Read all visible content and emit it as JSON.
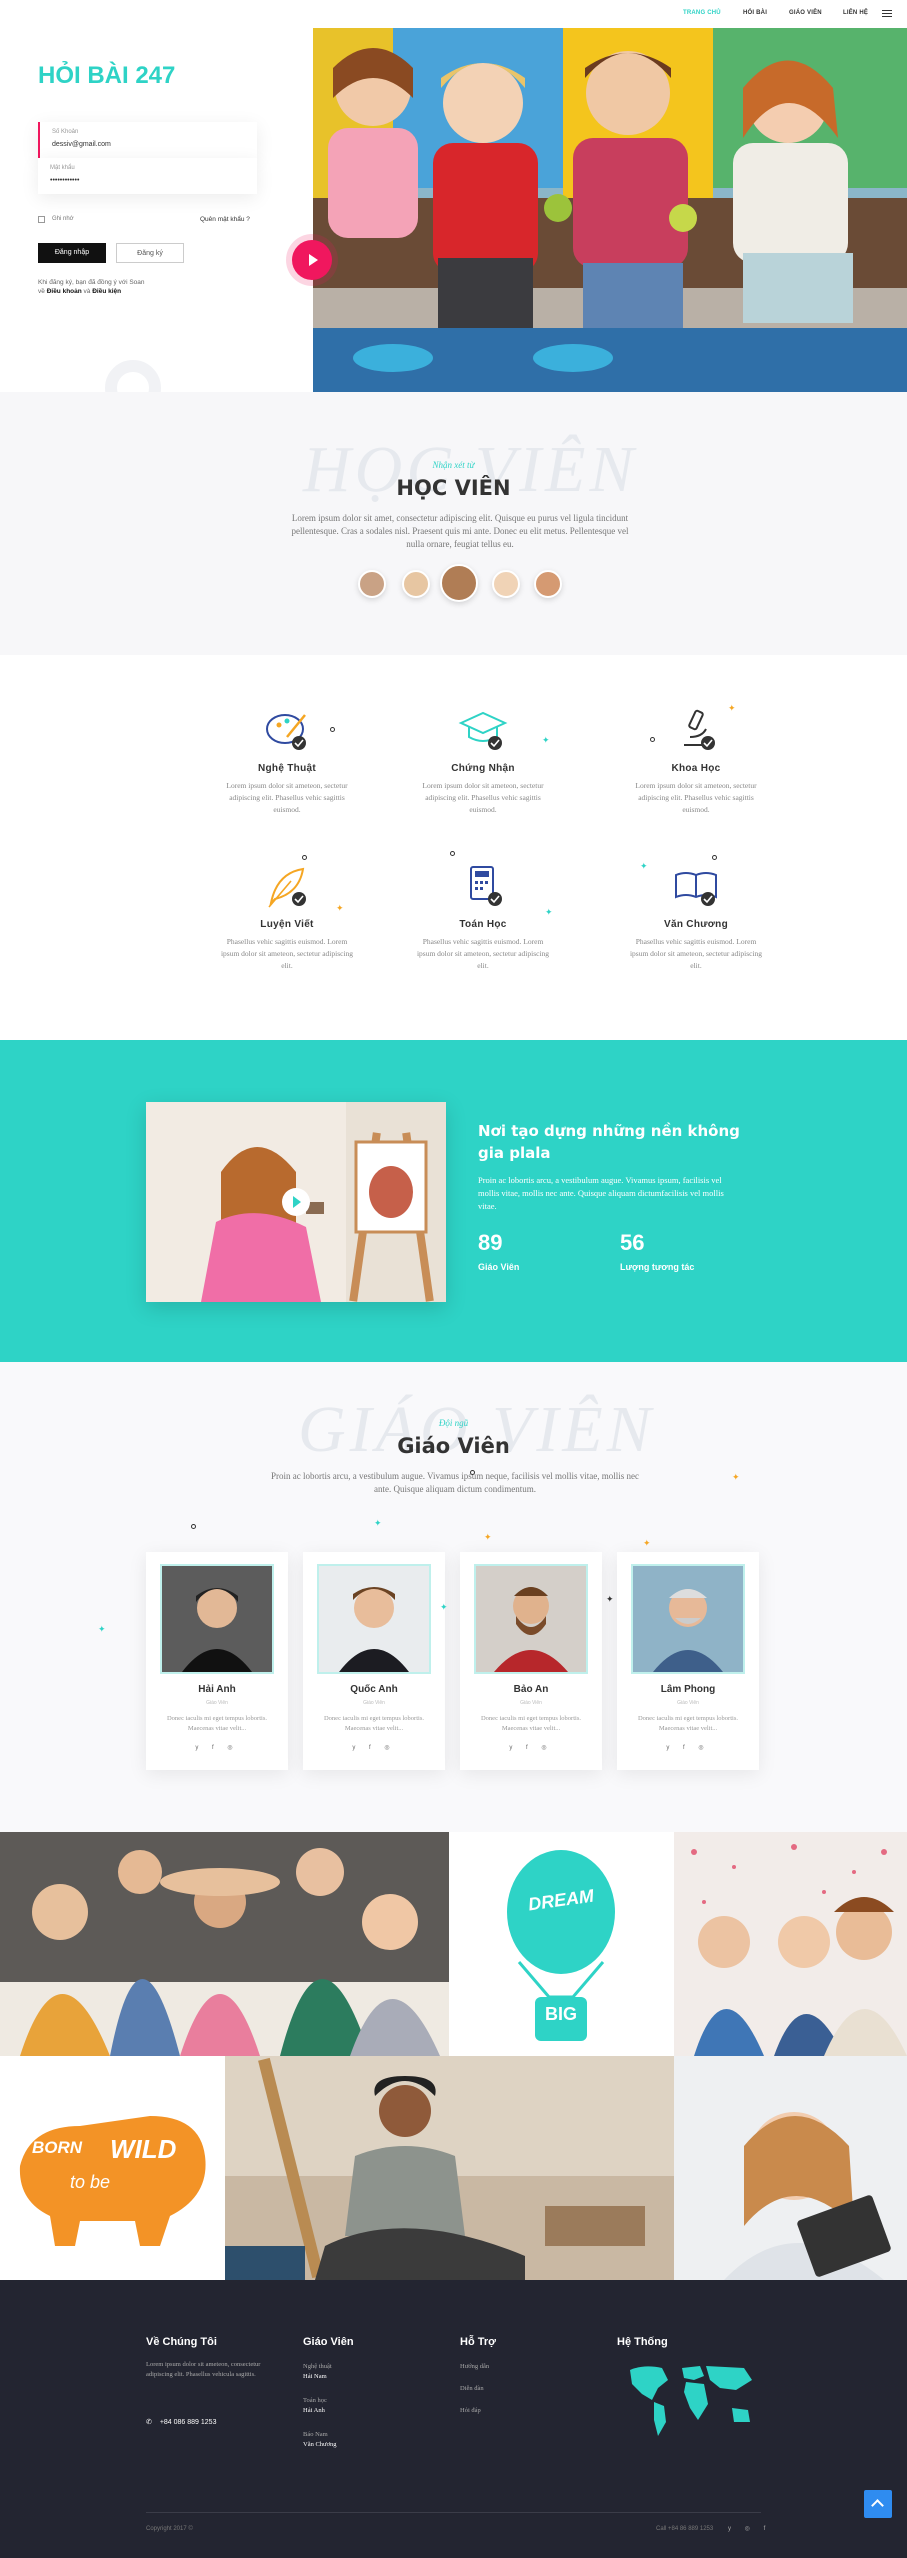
{
  "nav": {
    "items": [
      "TRANG CHỦ",
      "HỎI BÀI",
      "GIÁO VIÊN",
      "LIÊN HỆ"
    ]
  },
  "login": {
    "title": "HỎI BÀI 247",
    "user_label": "Số Khoản",
    "user_value": "dessiv@gmail.com",
    "pass_label": "Mật khẩu",
    "pass_value": "••••••••••••",
    "remember": "Ghi nhớ",
    "forgot": "Quên mật khẩu ?",
    "login_btn": "Đăng nhập",
    "register_btn": "Đăng ký",
    "terms_pre": "Khi đăng ký, bạn đã đồng ý với Soan",
    "terms_with": "về",
    "terms_link": "Điều khoản",
    "terms_and": "và",
    "terms_link2": "Điều kiện"
  },
  "students": {
    "sub": "Nhận xét từ",
    "title": "HỌC VIÊN",
    "ghost": "HỌC VIÊN",
    "text": "Lorem ipsum dolor sit amet, consectetur adipiscing elit. Quisque eu purus vel ligula tincidunt pellentesque. Cras a sodales nisl. Praesent quis mi ante. Donec eu elit metus. Pellentesque vel nulla ornare, feugiat tellus eu."
  },
  "features": [
    {
      "name": "Nghệ Thuật",
      "desc": "Lorem ipsum dolor sit ameteon, sectetur adipiscing elit. Phasellus vehic sagittis euismod."
    },
    {
      "name": "Chứng Nhận",
      "desc": "Lorem ipsum dolor sit ameteon, sectetur adipiscing elit. Phasellus vehic sagittis euismod."
    },
    {
      "name": "Khoa Học",
      "desc": "Lorem ipsum dolor sit ameteon, sectetur adipiscing elit. Phasellus vehic sagittis euismod."
    },
    {
      "name": "Luyện Viết",
      "desc": "Phasellus vehic sagittis euismod. Lorem ipsum dolor sit ameteon, sectetur adipiscing elit."
    },
    {
      "name": "Toán Học",
      "desc": "Phasellus vehic sagittis euismod. Lorem ipsum dolor sit ameteon, sectetur adipiscing elit."
    },
    {
      "name": "Văn Chương",
      "desc": "Phasellus vehic sagittis euismod. Lorem ipsum dolor sit ameteon, sectetur adipiscing elit."
    }
  ],
  "about": {
    "title": "Nơi tạo dựng những nền không gia plala",
    "text": "Proin ac lobortis arcu, a vestibulum augue. Vivamus ipsum, facilisis vel mollis vitae, mollis nec ante. Quisque aliquam dictumfacilisis vel mollis vitae.",
    "stats": [
      {
        "num": "89",
        "label": "Giáo Viên"
      },
      {
        "num": "56",
        "label": "Lượng tương tác"
      }
    ]
  },
  "teachers": {
    "sub": "Đội ngũ",
    "title": "Giáo Viên",
    "ghost": "GIÁO VIÊN",
    "text": "Proin ac lobortis arcu, a vestibulum augue. Vivamus ipsum neque, facilisis vel mollis vitae, mollis nec ante. Quisque aliquam dictum condimentum.",
    "list": [
      {
        "name": "Hải Anh",
        "role": "Giáo Viên",
        "desc": "Donec iaculis mi eget tempus lobortis. Maecenas vitae velit..."
      },
      {
        "name": "Quốc Anh",
        "role": "Giáo Viên",
        "desc": "Donec iaculis mi eget tempus lobortis. Maecenas vitae velit..."
      },
      {
        "name": "Bảo An",
        "role": "Giáo Viên",
        "desc": "Donec iaculis mi eget tempus lobortis. Maecenas vitae velit..."
      },
      {
        "name": "Lâm Phong",
        "role": "Giáo Viên",
        "desc": "Donec iaculis mi eget tempus lobortis. Maecenas vitae velit..."
      }
    ],
    "social": "y f ◎"
  },
  "gallery": {
    "dream_top": "DREAM",
    "dream_bottom": "BIG",
    "wild_top": "BORN",
    "wild_mid": "WILD",
    "wild_bottom": "to be"
  },
  "footer": {
    "about_title": "Về Chúng Tôi",
    "about_text": "Lorem ipsum dolor sit ameteon, consectetur adipiscing elit. Phasellus vehicula sagittis.",
    "phone": "+84 086 889 1253",
    "teachers_title": "Giáo Viên",
    "teachers": [
      {
        "subject": "Nghệ thuật",
        "name": "Hải Nam"
      },
      {
        "subject": "Toán học",
        "name": "Hải Anh"
      },
      {
        "subject": "Báo Nam",
        "name": "Văn Chương"
      }
    ],
    "support_title": "Hỗ Trợ",
    "support": [
      "Hướng dẫn",
      "Diễn đàn",
      "Hỏi đáp"
    ],
    "system_title": "Hệ Thống",
    "copyright": "Copyright 2017 ©",
    "bottom_phone": "Call +84 86 889 1253",
    "social": "y ◎ f"
  },
  "colors": {
    "accent": "#2ed3c6",
    "pink": "#f0175e",
    "dark": "#232531"
  }
}
